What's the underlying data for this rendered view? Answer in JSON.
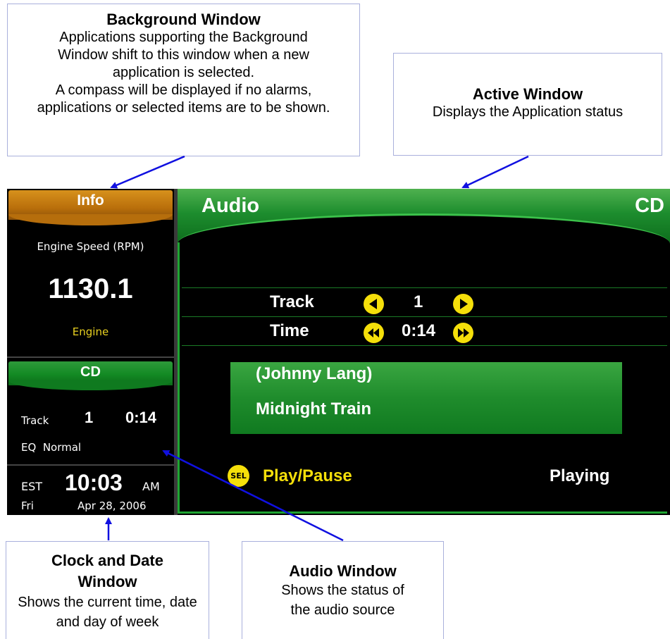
{
  "callouts": {
    "background_window": {
      "title": "Background Window",
      "body1": "Applications supporting the Background Window shift to this window when a new application is selected.",
      "body2": "A compass will be displayed if no alarms, applications or  selected items are to be shown."
    },
    "active_window": {
      "title": "Active Window",
      "body": "Displays the Application status"
    },
    "clock_window": {
      "title": "Clock and Date Window",
      "body": "Shows the current time, date and day of week"
    },
    "audio_window": {
      "title": "Audio Window",
      "body": "Shows the status of the audio source"
    }
  },
  "info_panel": {
    "tab": "Info",
    "label": "Engine Speed (RPM)",
    "value": "1130.1",
    "sub": "Engine"
  },
  "cd_panel": {
    "tab": "CD",
    "track_label": "Track",
    "track_number": "1",
    "time": "0:14",
    "eq": "EQ  Normal"
  },
  "clock": {
    "timezone": "EST",
    "time": "10:03",
    "ampm": "AM",
    "day": "Fri",
    "date": "Apr 28, 2006"
  },
  "audio": {
    "title": "Audio",
    "source": "CD",
    "track_label": "Track",
    "track_value": "1",
    "time_label": "Time",
    "time_value": "0:14",
    "artist": "(Johnny Lang)",
    "song": "Midnight Train",
    "sel_icon": "SEL",
    "action": "Play/Pause",
    "status": "Playing"
  },
  "colors": {
    "arrow": "#1010e0",
    "green": "#1d8d2e",
    "orange": "#c47a10",
    "yellow": "#f5df0a"
  }
}
